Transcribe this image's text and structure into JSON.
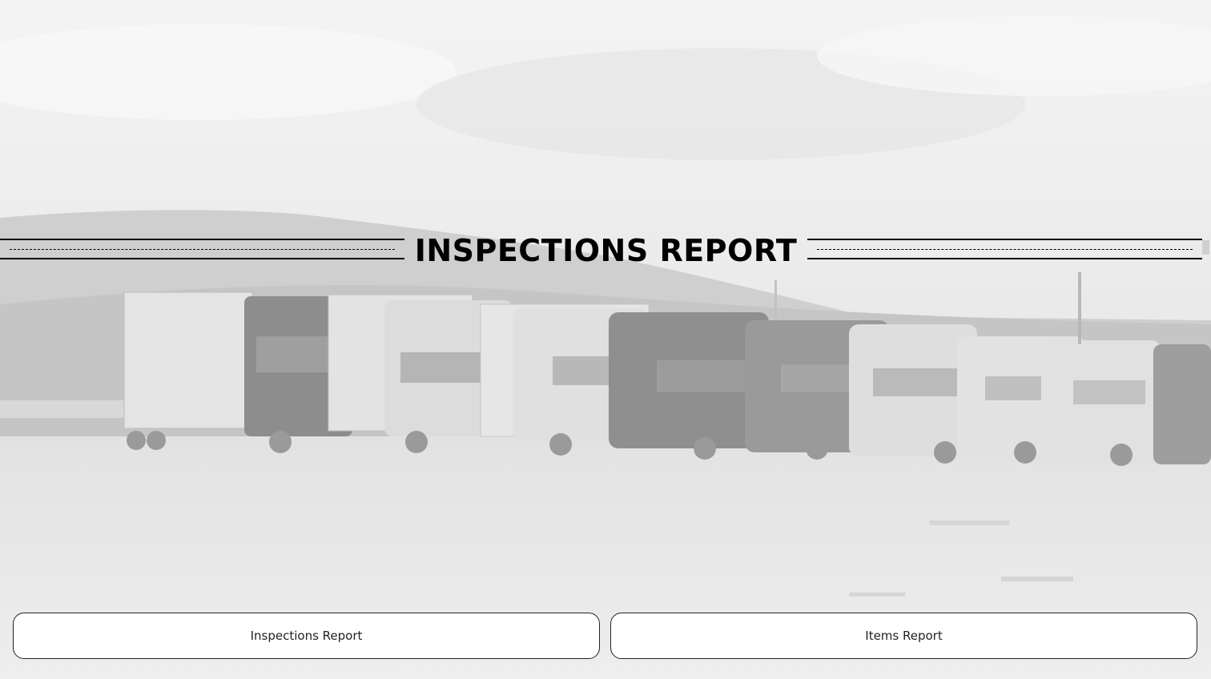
{
  "header": {
    "title": "INSPECTIONS REPORT"
  },
  "actions": {
    "inspections_report_label": "Inspections Report",
    "items_report_label": "Items Report"
  },
  "colors": {
    "background": "#efefef",
    "button_background": "#ffffff",
    "text": "#000000"
  }
}
